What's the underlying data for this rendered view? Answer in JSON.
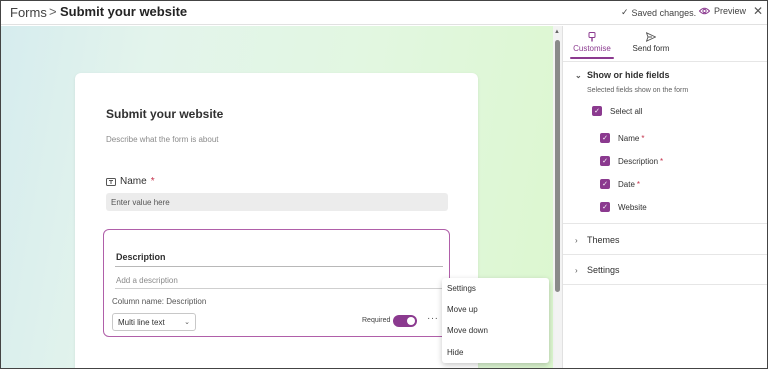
{
  "header": {
    "breadcrumb_root": "Forms",
    "breadcrumb_sep": ">",
    "title": "Submit your website",
    "saved": "Saved changes.",
    "preview": "Preview"
  },
  "form": {
    "title": "Submit your website",
    "description_placeholder": "Describe what the form is about",
    "name_question": "Name",
    "required_mark": "*",
    "name_placeholder": "Enter value here",
    "description_label": "Description",
    "add_description": "Add a description",
    "column_name": "Column name: Description",
    "field_type": "Multi line text",
    "required_label": "Required",
    "more": "···"
  },
  "context_menu": [
    "Settings",
    "Move up",
    "Move down",
    "Hide"
  ],
  "panel": {
    "tabs": [
      "Customise",
      "Send form"
    ],
    "show_hide_title": "Show or hide fields",
    "show_hide_note": "Selected fields show on the form",
    "select_all": "Select all",
    "fields": [
      {
        "label": "Name",
        "required": "*"
      },
      {
        "label": "Description",
        "required": "*"
      },
      {
        "label": "Date",
        "required": "*"
      },
      {
        "label": "Website",
        "required": ""
      }
    ],
    "themes": "Themes",
    "settings": "Settings"
  },
  "colors": {
    "accent": "#8b3a8f",
    "required": "#c4314b"
  },
  "icons": [
    "check-icon",
    "eye-icon",
    "close-icon",
    "question-type-icon",
    "chevron-down-icon",
    "paintbrush-icon",
    "send-icon",
    "chevron-right-icon"
  ]
}
